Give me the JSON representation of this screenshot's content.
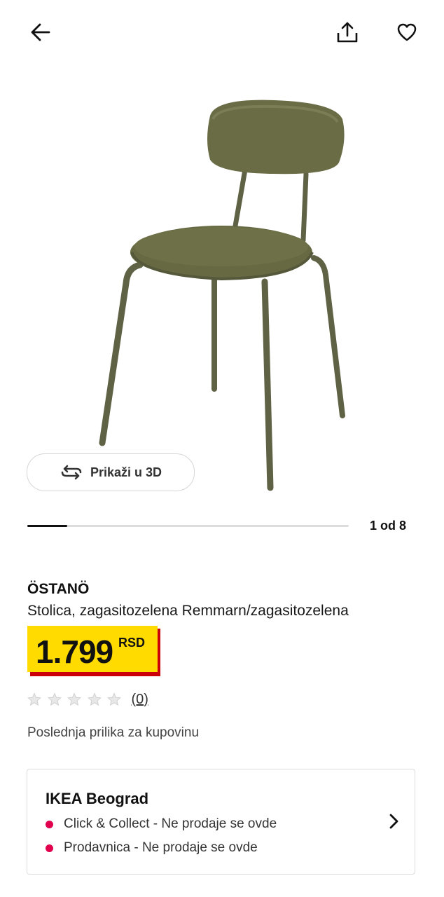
{
  "product": {
    "name": "ÖSTANÖ",
    "description": "Stolica, zagasitozelena Remmarn/zagasitozelena",
    "price": "1.799",
    "currency": "RSD",
    "rating": {
      "stars": 0,
      "max_stars": 5,
      "review_count": "(0)"
    },
    "note": "Poslednja prilika za kupovinu"
  },
  "gallery": {
    "view_3d_label": "Prikaži u 3D",
    "counter": "1 od 8",
    "current": 1,
    "total": 8
  },
  "store": {
    "name": "IKEA Beograd",
    "availability": [
      {
        "text": "Click & Collect - Ne prodaje se ovde",
        "status_color": "#e0004d"
      },
      {
        "text": "Prodavnica - Ne prodaje se ovde",
        "status_color": "#e0004d"
      }
    ]
  },
  "colors": {
    "price_bg": "#ffdb00",
    "price_shadow": "#cc0008",
    "chair_green": "#6a6c45"
  },
  "icons": {
    "back": "arrow-left",
    "share": "share-upload",
    "favorite": "heart-outline",
    "rotate": "rotate-3d",
    "store_chevron": "chevron-right",
    "star": "star-outline"
  }
}
